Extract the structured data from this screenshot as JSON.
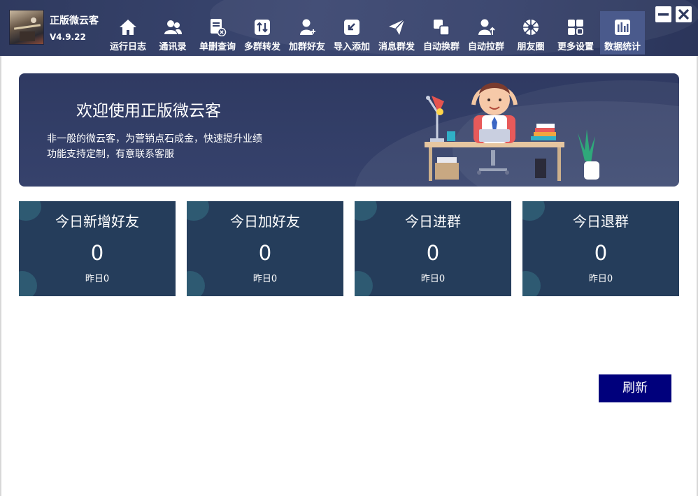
{
  "app": {
    "name": "正版微云客",
    "version": "V4.9.22"
  },
  "toolbar": [
    {
      "label": "运行日志",
      "icon": "home-icon"
    },
    {
      "label": "通讯录",
      "icon": "contacts-icon"
    },
    {
      "label": "单删查询",
      "icon": "delete-query-icon"
    },
    {
      "label": "多群转发",
      "icon": "forward-icon"
    },
    {
      "label": "加群好友",
      "icon": "add-friend-icon"
    },
    {
      "label": "导入添加",
      "icon": "import-icon"
    },
    {
      "label": "消息群发",
      "icon": "send-icon"
    },
    {
      "label": "自动换群",
      "icon": "switch-group-icon"
    },
    {
      "label": "自动拉群",
      "icon": "pull-group-icon"
    },
    {
      "label": "朋友圈",
      "icon": "moments-icon"
    },
    {
      "label": "更多设置",
      "icon": "grid-icon"
    },
    {
      "label": "数据统计",
      "icon": "bar-chart-icon"
    }
  ],
  "active_tab": "数据统计",
  "banner": {
    "title": "欢迎使用正版微云客",
    "line1": "非一般的微云客，为营销点石成金，快速提升业绩",
    "line2": "功能支持定制，有意联系客服"
  },
  "stats": [
    {
      "title": "今日新增好友",
      "value": "0",
      "yesterday": "昨日0"
    },
    {
      "title": "今日加好友",
      "value": "0",
      "yesterday": "昨日0"
    },
    {
      "title": "今日进群",
      "value": "0",
      "yesterday": "昨日0"
    },
    {
      "title": "今日退群",
      "value": "0",
      "yesterday": "昨日0"
    }
  ],
  "refresh_label": "刷新",
  "colors": {
    "toolbar_bg": "#353f66",
    "card_bg": "#253d5b",
    "refresh_bg": "#00007c",
    "active_tab_bg": "#4a5a8c"
  }
}
